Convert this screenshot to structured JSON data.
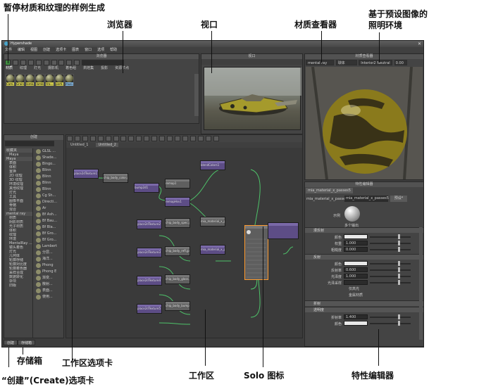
{
  "callouts": {
    "pause_swatch": "暂停材质和纹理的样例生成",
    "browser": "浏览器",
    "viewport": "视口",
    "material_viewer": "材质查看器",
    "ibl_line1": "基于预设图像的",
    "ibl_line2": "照明环境",
    "stash": "存储箱",
    "work_tabs": "工作区选项卡",
    "work_area": "工作区",
    "solo_icon": "Solo 图标",
    "attr_editor": "特性编辑器",
    "create_tab": "“创建”(Create)选项卡"
  },
  "app": {
    "title": "Hypershade",
    "menus": [
      "文件",
      "编辑",
      "视图",
      "创建",
      "选项卡",
      "图表",
      "窗口",
      "选项",
      "帮助"
    ]
  },
  "browser": {
    "title": "浏览器",
    "tabs": [
      "材质",
      "纹理",
      "灯光",
      "摄影机",
      "着色组",
      "烘焙集",
      "投影",
      "资源节点"
    ],
    "swatches": [
      "Cam...",
      "Grain",
      "lamb...",
      "lamb",
      "tra...",
      "parti...",
      "musi..."
    ]
  },
  "viewport": {
    "title": "视口"
  },
  "material_viewer": {
    "title": "材质查看器",
    "renderer": "mental ray",
    "shape": "球体",
    "env": "Interior2 Neutral",
    "exposure": "0.00"
  },
  "create": {
    "title": "创建",
    "tree": [
      {
        "label": "收藏夹",
        "hdr": true
      },
      {
        "label": "Maya",
        "hdr": false
      },
      {
        "label": "Maya",
        "hdr": true
      },
      {
        "label": "表面",
        "hdr": false
      },
      {
        "label": "体积",
        "hdr": false
      },
      {
        "label": "置换",
        "hdr": false
      },
      {
        "label": "2D 纹理",
        "hdr": false
      },
      {
        "label": "3D 纹理",
        "hdr": false
      },
      {
        "label": "环境纹理",
        "hdr": false
      },
      {
        "label": "其他纹理",
        "hdr": false
      },
      {
        "label": "灯光",
        "hdr": false
      },
      {
        "label": "工具",
        "hdr": false
      },
      {
        "label": "图像平面",
        "hdr": false
      },
      {
        "label": "骨骼",
        "hdr": false
      },
      {
        "label": "混合",
        "hdr": false
      },
      {
        "label": "mental ray",
        "hdr": true
      },
      {
        "label": "材质",
        "hdr": false
      },
      {
        "label": "阴影材质",
        "hdr": false
      },
      {
        "label": "光子材质",
        "hdr": false
      },
      {
        "label": "体积",
        "hdr": false
      },
      {
        "label": "纹理",
        "hdr": false
      },
      {
        "label": "环境",
        "hdr": false
      },
      {
        "label": "MentalRay ...",
        "hdr": false
      },
      {
        "label": "镜头着色",
        "hdr": false
      },
      {
        "label": "灯光",
        "hdr": false
      },
      {
        "label": "几何体",
        "hdr": false
      },
      {
        "label": "轮廓存储",
        "hdr": false
      },
      {
        "label": "轮廓对比度",
        "hdr": false
      },
      {
        "label": "轮廓着色器",
        "hdr": false
      },
      {
        "label": "采样合成",
        "hdr": false
      },
      {
        "label": "数据转化",
        "hdr": false
      },
      {
        "label": "杂项",
        "hdr": false
      },
      {
        "label": "旧版",
        "hdr": false
      }
    ],
    "nodes": [
      "GLSL ...",
      "Shade...",
      "Bingo...",
      "Blinn",
      "Blinn",
      "Blinn",
      "Blinn",
      "Cg Sh...",
      "Directi...",
      "Ar",
      "Bf Ash...",
      "Bf Bau...",
      "Bf Bla...",
      "Bf Gro...",
      "Bf Gro...",
      "Lambert",
      "分层...",
      "海洋...",
      "Phong",
      "Phong E",
      "渐变...",
      "散射...",
      "表面...",
      "使用..."
    ],
    "search": "",
    "tab_create": "创建",
    "tab_stash": "存储箱"
  },
  "workarea": {
    "title": "",
    "tabs": [
      "Untitled_1",
      "Untitled_2"
    ],
    "nodes": [
      {
        "label": "place2dTexture1",
        "style": "purple"
      },
      {
        "label": "chip_body_color.jpg",
        "style": "grey"
      },
      {
        "label": "bump2d1",
        "style": "purple"
      },
      {
        "label": "remap1",
        "style": "grey"
      },
      {
        "label": "remapHsv1",
        "style": "purple"
      },
      {
        "label": "blendColors1",
        "style": "purple"
      },
      {
        "label": "place2dTexture2",
        "style": "purple"
      },
      {
        "label": "chip_body_spec.jpg",
        "style": "grey"
      },
      {
        "label": "place2dTexture3",
        "style": "purple"
      },
      {
        "label": "chip_body_refl.jpg",
        "style": "grey"
      },
      {
        "label": "place2dTexture4",
        "style": "purple"
      },
      {
        "label": "chip_body_gloss.jpg",
        "style": "grey"
      },
      {
        "label": "place2dTexture5",
        "style": "purple"
      },
      {
        "label": "chip_body_bump.jpg",
        "style": "grey"
      },
      {
        "label": "mia_material_x_passes5",
        "style": "grey"
      },
      {
        "label": "mia_material_x_passes5SG",
        "style": "purple"
      }
    ]
  },
  "attr": {
    "title": "特性编辑器",
    "tab": "mia_material_x_passes5",
    "name_label": "mia_material_x_passes:",
    "name_value": "mia_material_x_passes5",
    "preset_btn": "预设*",
    "sample_label": "示例",
    "multi_check": "多个输出",
    "sections": [
      "漫反射",
      "反射",
      "折射",
      "透明度"
    ],
    "rows_diffuse": [
      {
        "label": "颜色",
        "value": ""
      },
      {
        "label": "权重",
        "value": "1.000"
      },
      {
        "label": "粗糙度",
        "value": "0.000"
      }
    ],
    "rows_reflect": [
      {
        "label": "颜色",
        "value": ""
      },
      {
        "label": "反射率",
        "value": "0.600"
      },
      {
        "label": "光泽度",
        "value": "1.000"
      },
      {
        "label": "光泽采样",
        "value": ""
      }
    ],
    "check1": "仅高光",
    "check2": "金属材质",
    "rows_refract": [
      {
        "label": "折射率",
        "value": "1.400"
      },
      {
        "label": "颜色",
        "value": ""
      }
    ]
  }
}
